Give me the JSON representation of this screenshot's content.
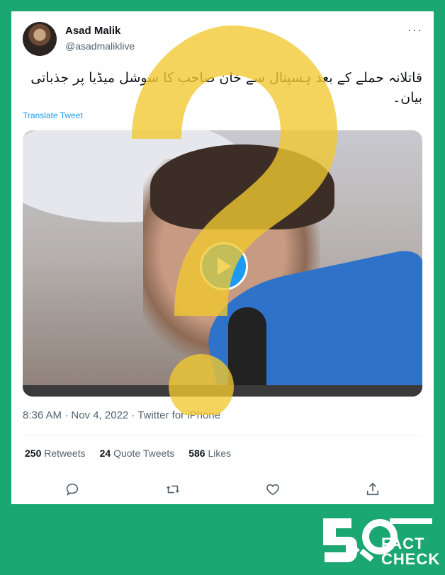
{
  "tweet": {
    "author_name": "Asad Malik",
    "author_handle": "@asadmaliklive",
    "more_label": "···",
    "text": "قاتلانہ حملے کے بعد ہسپتال سے خان صاحب کا سوشل میڈیا پر جذباتی بیان۔",
    "translate_label": "Translate Tweet",
    "timestamp": "8:36 AM · Nov 4, 2022 · Twitter for iPhone",
    "retweets_count": "250",
    "retweets_label": "Retweets",
    "quote_count": "24",
    "quote_label": "Quote Tweets",
    "likes_count": "586",
    "likes_label": "Likes"
  },
  "actions": [
    "reply-icon",
    "retweet-icon",
    "like-icon",
    "share-icon"
  ],
  "watermark": {
    "brand_top": "FACT",
    "brand_bottom": "CHECK"
  },
  "colors": {
    "background": "#1aa772",
    "accent": "#1d9bf0",
    "overlay": "#f2c92f"
  }
}
